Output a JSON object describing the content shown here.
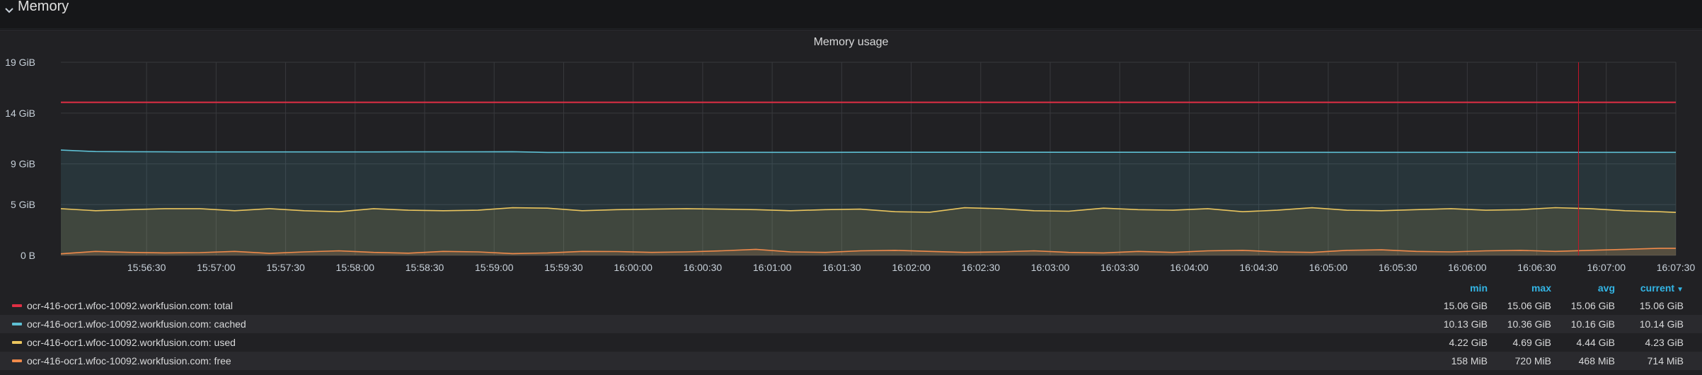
{
  "row": {
    "title": "Memory"
  },
  "panel": {
    "title": "Memory usage"
  },
  "chart_data": {
    "type": "area",
    "title": "Memory usage",
    "y_unit": "GiB",
    "ylim": [
      0,
      19
    ],
    "y_ticks": [
      {
        "value": 0,
        "label": "0 B"
      },
      {
        "value": 5,
        "label": "5 GiB"
      },
      {
        "value": 9,
        "label": "9 GiB"
      },
      {
        "value": 14,
        "label": "14 GiB"
      },
      {
        "value": 19,
        "label": "19 GiB"
      }
    ],
    "x_range": [
      "15:55:53",
      "16:07:30"
    ],
    "x_tick_labels": [
      "15:56:30",
      "15:57:00",
      "15:57:30",
      "15:58:00",
      "15:58:30",
      "15:59:00",
      "15:59:30",
      "16:00:00",
      "16:00:30",
      "16:01:00",
      "16:01:30",
      "16:02:00",
      "16:02:30",
      "16:03:00",
      "16:03:30",
      "16:04:00",
      "16:04:30",
      "16:05:00",
      "16:05:30",
      "16:06:00",
      "16:06:30",
      "16:07:00",
      "16:07:30"
    ],
    "grid": true,
    "threshold_marker_time": "16:06:48",
    "sample_times": [
      "15:55:53",
      "15:56:08",
      "15:56:23",
      "15:56:38",
      "15:56:53",
      "15:57:08",
      "15:57:23",
      "15:57:38",
      "15:57:53",
      "15:58:08",
      "15:58:23",
      "15:58:38",
      "15:58:53",
      "15:59:08",
      "15:59:23",
      "15:59:38",
      "15:59:53",
      "16:00:08",
      "16:00:23",
      "16:00:38",
      "16:00:53",
      "16:01:08",
      "16:01:23",
      "16:01:38",
      "16:01:53",
      "16:02:08",
      "16:02:23",
      "16:02:38",
      "16:02:53",
      "16:03:08",
      "16:03:23",
      "16:03:38",
      "16:03:53",
      "16:04:08",
      "16:04:23",
      "16:04:38",
      "16:04:53",
      "16:05:08",
      "16:05:23",
      "16:05:38",
      "16:05:53",
      "16:06:08",
      "16:06:23",
      "16:06:38",
      "16:06:53",
      "16:07:08",
      "16:07:23",
      "16:07:30"
    ],
    "series": [
      {
        "name": "ocr-416-ocr1.wfoc-10092.workfusion.com: total",
        "color": "#e02f44",
        "fill": false,
        "values": [
          15.06,
          15.06,
          15.06,
          15.06,
          15.06,
          15.06,
          15.06,
          15.06,
          15.06,
          15.06,
          15.06,
          15.06,
          15.06,
          15.06,
          15.06,
          15.06,
          15.06,
          15.06,
          15.06,
          15.06,
          15.06,
          15.06,
          15.06,
          15.06,
          15.06,
          15.06,
          15.06,
          15.06,
          15.06,
          15.06,
          15.06,
          15.06,
          15.06,
          15.06,
          15.06,
          15.06,
          15.06,
          15.06,
          15.06,
          15.06,
          15.06,
          15.06,
          15.06,
          15.06,
          15.06,
          15.06,
          15.06,
          15.06
        ]
      },
      {
        "name": "ocr-416-ocr1.wfoc-10092.workfusion.com: cached",
        "color": "#5ec0d4",
        "fill": true,
        "values": [
          10.36,
          10.22,
          10.2,
          10.19,
          10.18,
          10.18,
          10.18,
          10.18,
          10.18,
          10.18,
          10.19,
          10.19,
          10.19,
          10.2,
          10.13,
          10.13,
          10.13,
          10.13,
          10.13,
          10.14,
          10.14,
          10.14,
          10.14,
          10.15,
          10.15,
          10.15,
          10.15,
          10.15,
          10.15,
          10.15,
          10.15,
          10.15,
          10.15,
          10.15,
          10.14,
          10.14,
          10.14,
          10.14,
          10.14,
          10.14,
          10.14,
          10.14,
          10.14,
          10.14,
          10.14,
          10.14,
          10.14,
          10.14
        ]
      },
      {
        "name": "ocr-416-ocr1.wfoc-10092.workfusion.com: used",
        "color": "#eac55e",
        "fill": true,
        "values": [
          4.6,
          4.4,
          4.5,
          4.6,
          4.6,
          4.4,
          4.6,
          4.4,
          4.3,
          4.6,
          4.45,
          4.4,
          4.45,
          4.69,
          4.65,
          4.4,
          4.5,
          4.55,
          4.6,
          4.55,
          4.5,
          4.4,
          4.5,
          4.55,
          4.3,
          4.25,
          4.69,
          4.6,
          4.4,
          4.35,
          4.65,
          4.5,
          4.45,
          4.6,
          4.3,
          4.45,
          4.69,
          4.45,
          4.4,
          4.5,
          4.6,
          4.45,
          4.5,
          4.7,
          4.6,
          4.4,
          4.3,
          4.23
        ]
      },
      {
        "name": "ocr-416-ocr1.wfoc-10092.workfusion.com: free",
        "color": "#f08a4b",
        "fill": true,
        "values": [
          0.16,
          0.4,
          0.3,
          0.25,
          0.28,
          0.4,
          0.2,
          0.35,
          0.45,
          0.3,
          0.22,
          0.4,
          0.35,
          0.18,
          0.25,
          0.4,
          0.38,
          0.3,
          0.35,
          0.45,
          0.6,
          0.35,
          0.3,
          0.45,
          0.5,
          0.4,
          0.3,
          0.35,
          0.45,
          0.3,
          0.25,
          0.4,
          0.3,
          0.45,
          0.5,
          0.35,
          0.3,
          0.5,
          0.55,
          0.4,
          0.35,
          0.45,
          0.5,
          0.4,
          0.5,
          0.6,
          0.7,
          0.7
        ]
      }
    ]
  },
  "legend": {
    "headers": {
      "min": "min",
      "max": "max",
      "avg": "avg",
      "current": "current"
    },
    "rows": [
      {
        "name": "ocr-416-ocr1.wfoc-10092.workfusion.com: total",
        "color": "#e02f44",
        "min": "15.06 GiB",
        "max": "15.06 GiB",
        "avg": "15.06 GiB",
        "current": "15.06 GiB"
      },
      {
        "name": "ocr-416-ocr1.wfoc-10092.workfusion.com: cached",
        "color": "#5ec0d4",
        "min": "10.13 GiB",
        "max": "10.36 GiB",
        "avg": "10.16 GiB",
        "current": "10.14 GiB"
      },
      {
        "name": "ocr-416-ocr1.wfoc-10092.workfusion.com: used",
        "color": "#eac55e",
        "min": "4.22 GiB",
        "max": "4.69 GiB",
        "avg": "4.44 GiB",
        "current": "4.23 GiB"
      },
      {
        "name": "ocr-416-ocr1.wfoc-10092.workfusion.com: free",
        "color": "#f08a4b",
        "min": "158 MiB",
        "max": "720 MiB",
        "avg": "468 MiB",
        "current": "714 MiB"
      }
    ]
  }
}
